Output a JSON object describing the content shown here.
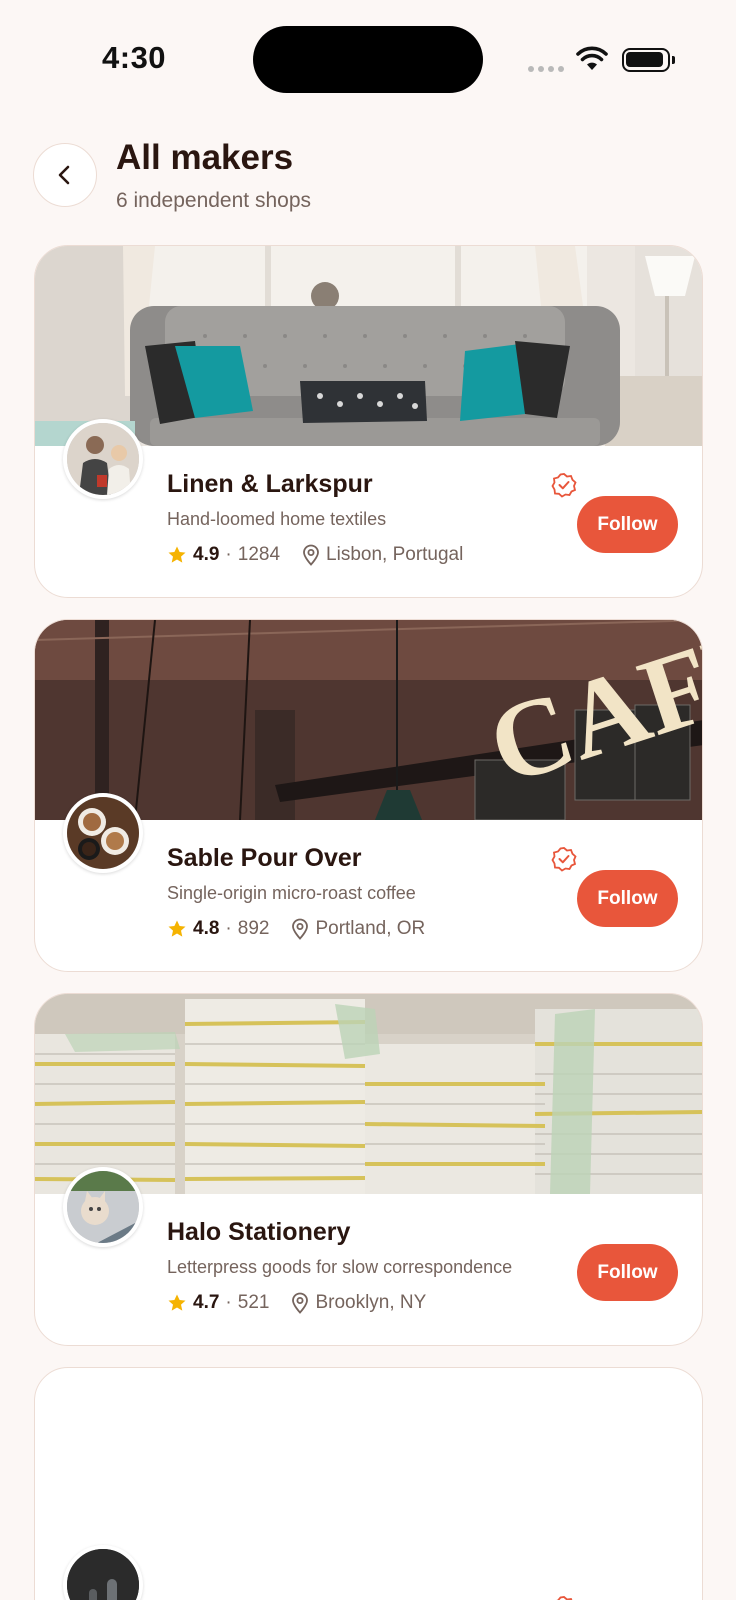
{
  "status_bar": {
    "time": "4:30"
  },
  "header": {
    "title": "All makers",
    "subtitle": "6 independent shops"
  },
  "shops": [
    {
      "name": "Linen & Larkspur",
      "description": "Hand-loomed home textiles",
      "rating": "4.9",
      "reviews": "1284",
      "location": "Lisbon, Portugal",
      "follow_label": "Follow"
    },
    {
      "name": "Sable Pour Over",
      "description": "Single-origin micro-roast coffee",
      "rating": "4.8",
      "reviews": "892",
      "location": "Portland, OR",
      "follow_label": "Follow"
    },
    {
      "name": "Halo Stationery",
      "description": "Letterpress goods for slow correspondence",
      "rating": "4.7",
      "reviews": "521",
      "location": "Brooklyn, NY",
      "follow_label": "Follow"
    }
  ],
  "cover_images": {
    "card1": "CAFE"
  },
  "colors": {
    "accent": "#e8563b",
    "background": "#fcf7f5",
    "star": "#f5b301"
  }
}
